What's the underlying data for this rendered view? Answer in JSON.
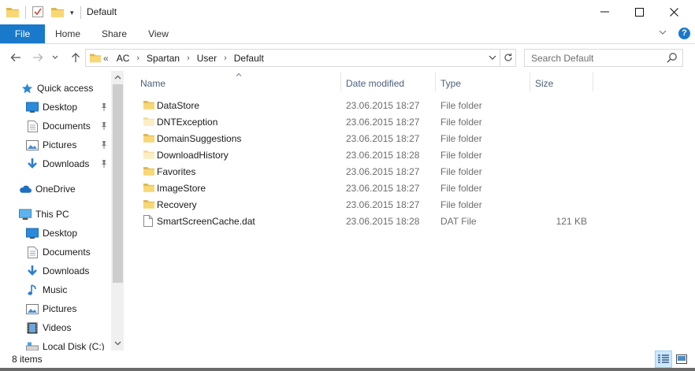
{
  "window": {
    "title": "Default",
    "minimize": "—",
    "maximize": "☐",
    "close": "✕"
  },
  "ribbon": {
    "tabs": [
      "File",
      "Home",
      "Share",
      "View"
    ],
    "collapse": "⌄",
    "help": "?"
  },
  "address": {
    "overflow": "«",
    "crumbs": [
      "AC",
      "Spartan",
      "User",
      "Default"
    ],
    "separator": "›"
  },
  "search": {
    "placeholder": "Search Default"
  },
  "nav": {
    "quick_access": "Quick access",
    "quick_items": [
      "Desktop",
      "Documents",
      "Pictures",
      "Downloads"
    ],
    "onedrive": "OneDrive",
    "this_pc": "This PC",
    "pc_items": [
      "Desktop",
      "Documents",
      "Downloads",
      "Music",
      "Pictures",
      "Videos",
      "Local Disk (C:)"
    ]
  },
  "columns": {
    "name": "Name",
    "date": "Date modified",
    "type": "Type",
    "size": "Size"
  },
  "files": [
    {
      "name": "DataStore",
      "date": "23.06.2015 18:27",
      "type": "File folder",
      "size": "",
      "icon": "folder-filled"
    },
    {
      "name": "DNTException",
      "date": "23.06.2015 18:27",
      "type": "File folder",
      "size": "",
      "icon": "folder-empty"
    },
    {
      "name": "DomainSuggestions",
      "date": "23.06.2015 18:27",
      "type": "File folder",
      "size": "",
      "icon": "folder-filled"
    },
    {
      "name": "DownloadHistory",
      "date": "23.06.2015 18:28",
      "type": "File folder",
      "size": "",
      "icon": "folder-empty"
    },
    {
      "name": "Favorites",
      "date": "23.06.2015 18:27",
      "type": "File folder",
      "size": "",
      "icon": "folder-filled"
    },
    {
      "name": "ImageStore",
      "date": "23.06.2015 18:27",
      "type": "File folder",
      "size": "",
      "icon": "folder-filled"
    },
    {
      "name": "Recovery",
      "date": "23.06.2015 18:27",
      "type": "File folder",
      "size": "",
      "icon": "folder-filled"
    },
    {
      "name": "SmartScreenCache.dat",
      "date": "23.06.2015 18:28",
      "type": "DAT File",
      "size": "121 KB",
      "icon": "file-blank"
    }
  ],
  "status": {
    "count": "8 items"
  },
  "colors": {
    "accent": "#1979ca",
    "folder": "#f8d775",
    "folder_dark": "#e0b44a",
    "header_text": "#4c607a"
  }
}
